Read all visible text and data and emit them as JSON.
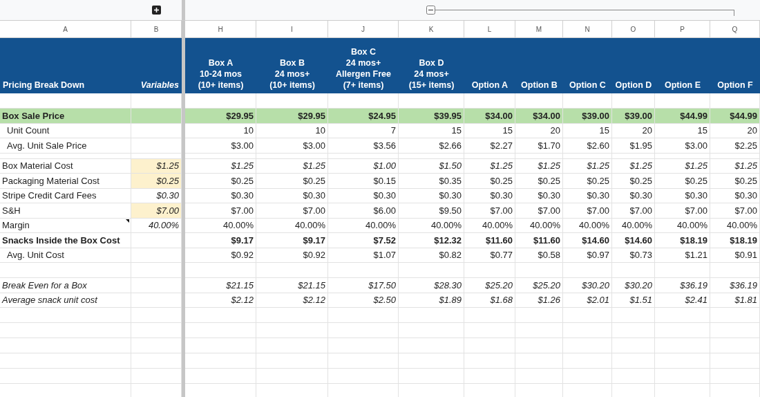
{
  "groups": [
    {
      "expanded": false
    },
    {
      "expanded": true
    }
  ],
  "column_letters": [
    "A",
    "B",
    "H",
    "I",
    "J",
    "K",
    "L",
    "M",
    "N",
    "O",
    "P",
    "Q"
  ],
  "header": {
    "label": "Pricing Break Down",
    "variables": "Variables",
    "columns": [
      {
        "lines": [
          "Box A",
          "10-24 mos",
          "(10+ items)"
        ]
      },
      {
        "lines": [
          "Box B",
          "24 mos+",
          "(10+ items)"
        ]
      },
      {
        "lines": [
          "Box C",
          "24 mos+",
          "Allergen Free",
          "(7+ items)"
        ]
      },
      {
        "lines": [
          "Box D",
          "24 mos+",
          "(15+ items)"
        ]
      },
      {
        "lines": [
          "Option A"
        ]
      },
      {
        "lines": [
          "Option B"
        ]
      },
      {
        "lines": [
          "Option C"
        ]
      },
      {
        "lines": [
          "Option D"
        ]
      },
      {
        "lines": [
          "Option E"
        ]
      },
      {
        "lines": [
          "Option F"
        ]
      }
    ]
  },
  "rows": [
    {
      "kind": "blank"
    },
    {
      "kind": "headline",
      "label": "Box Sale Price",
      "values": [
        "$29.95",
        "$29.95",
        "$24.95",
        "$39.95",
        "$34.00",
        "$34.00",
        "$39.00",
        "$39.00",
        "$44.99",
        "$44.99"
      ]
    },
    {
      "kind": "sub",
      "label": "Unit Count",
      "values": [
        "10",
        "10",
        "7",
        "15",
        "15",
        "20",
        "15",
        "20",
        "15",
        "20"
      ]
    },
    {
      "kind": "sub",
      "label": "Avg. Unit Sale Price",
      "values": [
        "$3.00",
        "$3.00",
        "$3.56",
        "$2.66",
        "$2.27",
        "$1.70",
        "$2.60",
        "$1.95",
        "$3.00",
        "$2.25"
      ]
    },
    {
      "kind": "gap"
    },
    {
      "kind": "cost",
      "label": "Box Material Cost",
      "variable": {
        "text": "$1.25",
        "input": true
      },
      "values": [
        "$1.25",
        "$1.25",
        "$1.00",
        "$1.50",
        "$1.25",
        "$1.25",
        "$1.25",
        "$1.25",
        "$1.25",
        "$1.25"
      ]
    },
    {
      "kind": "line",
      "label": "Packaging Material Cost",
      "variable": {
        "text": "$0.25",
        "input": true
      },
      "values": [
        "$0.25",
        "$0.25",
        "$0.15",
        "$0.35",
        "$0.25",
        "$0.25",
        "$0.25",
        "$0.25",
        "$0.25",
        "$0.25"
      ]
    },
    {
      "kind": "line",
      "label": "Stripe Credit Card Fees",
      "variable": {
        "text": "$0.30",
        "input": false
      },
      "values": [
        "$0.30",
        "$0.30",
        "$0.30",
        "$0.30",
        "$0.30",
        "$0.30",
        "$0.30",
        "$0.30",
        "$0.30",
        "$0.30"
      ]
    },
    {
      "kind": "line",
      "label": "S&H",
      "variable": {
        "text": "$7.00",
        "input": true
      },
      "values": [
        "$7.00",
        "$7.00",
        "$6.00",
        "$9.50",
        "$7.00",
        "$7.00",
        "$7.00",
        "$7.00",
        "$7.00",
        "$7.00"
      ]
    },
    {
      "kind": "line",
      "label": "Margin",
      "note": true,
      "variable": {
        "text": "40.00%",
        "input": false
      },
      "values": [
        "40.00%",
        "40.00%",
        "40.00%",
        "40.00%",
        "40.00%",
        "40.00%",
        "40.00%",
        "40.00%",
        "40.00%",
        "40.00%"
      ]
    },
    {
      "kind": "total",
      "label": "Snacks Inside the Box Cost",
      "values": [
        "$9.17",
        "$9.17",
        "$7.52",
        "$12.32",
        "$11.60",
        "$11.60",
        "$14.60",
        "$14.60",
        "$18.19",
        "$18.19"
      ]
    },
    {
      "kind": "sub",
      "label": "Avg. Unit Cost",
      "values": [
        "$0.92",
        "$0.92",
        "$1.07",
        "$0.82",
        "$0.77",
        "$0.58",
        "$0.97",
        "$0.73",
        "$1.21",
        "$0.91"
      ]
    },
    {
      "kind": "blank"
    },
    {
      "kind": "estimate",
      "label": "Break Even for a Box",
      "values": [
        "$21.15",
        "$21.15",
        "$17.50",
        "$28.30",
        "$25.20",
        "$25.20",
        "$30.20",
        "$30.20",
        "$36.19",
        "$36.19"
      ]
    },
    {
      "kind": "estimate",
      "label": "Average snack unit cost",
      "values": [
        "$2.12",
        "$2.12",
        "$2.50",
        "$1.89",
        "$1.68",
        "$1.26",
        "$2.01",
        "$1.51",
        "$2.41",
        "$1.81"
      ]
    },
    {
      "kind": "blank"
    },
    {
      "kind": "blank"
    },
    {
      "kind": "blank"
    },
    {
      "kind": "blank"
    },
    {
      "kind": "blank"
    },
    {
      "kind": "blank"
    }
  ]
}
